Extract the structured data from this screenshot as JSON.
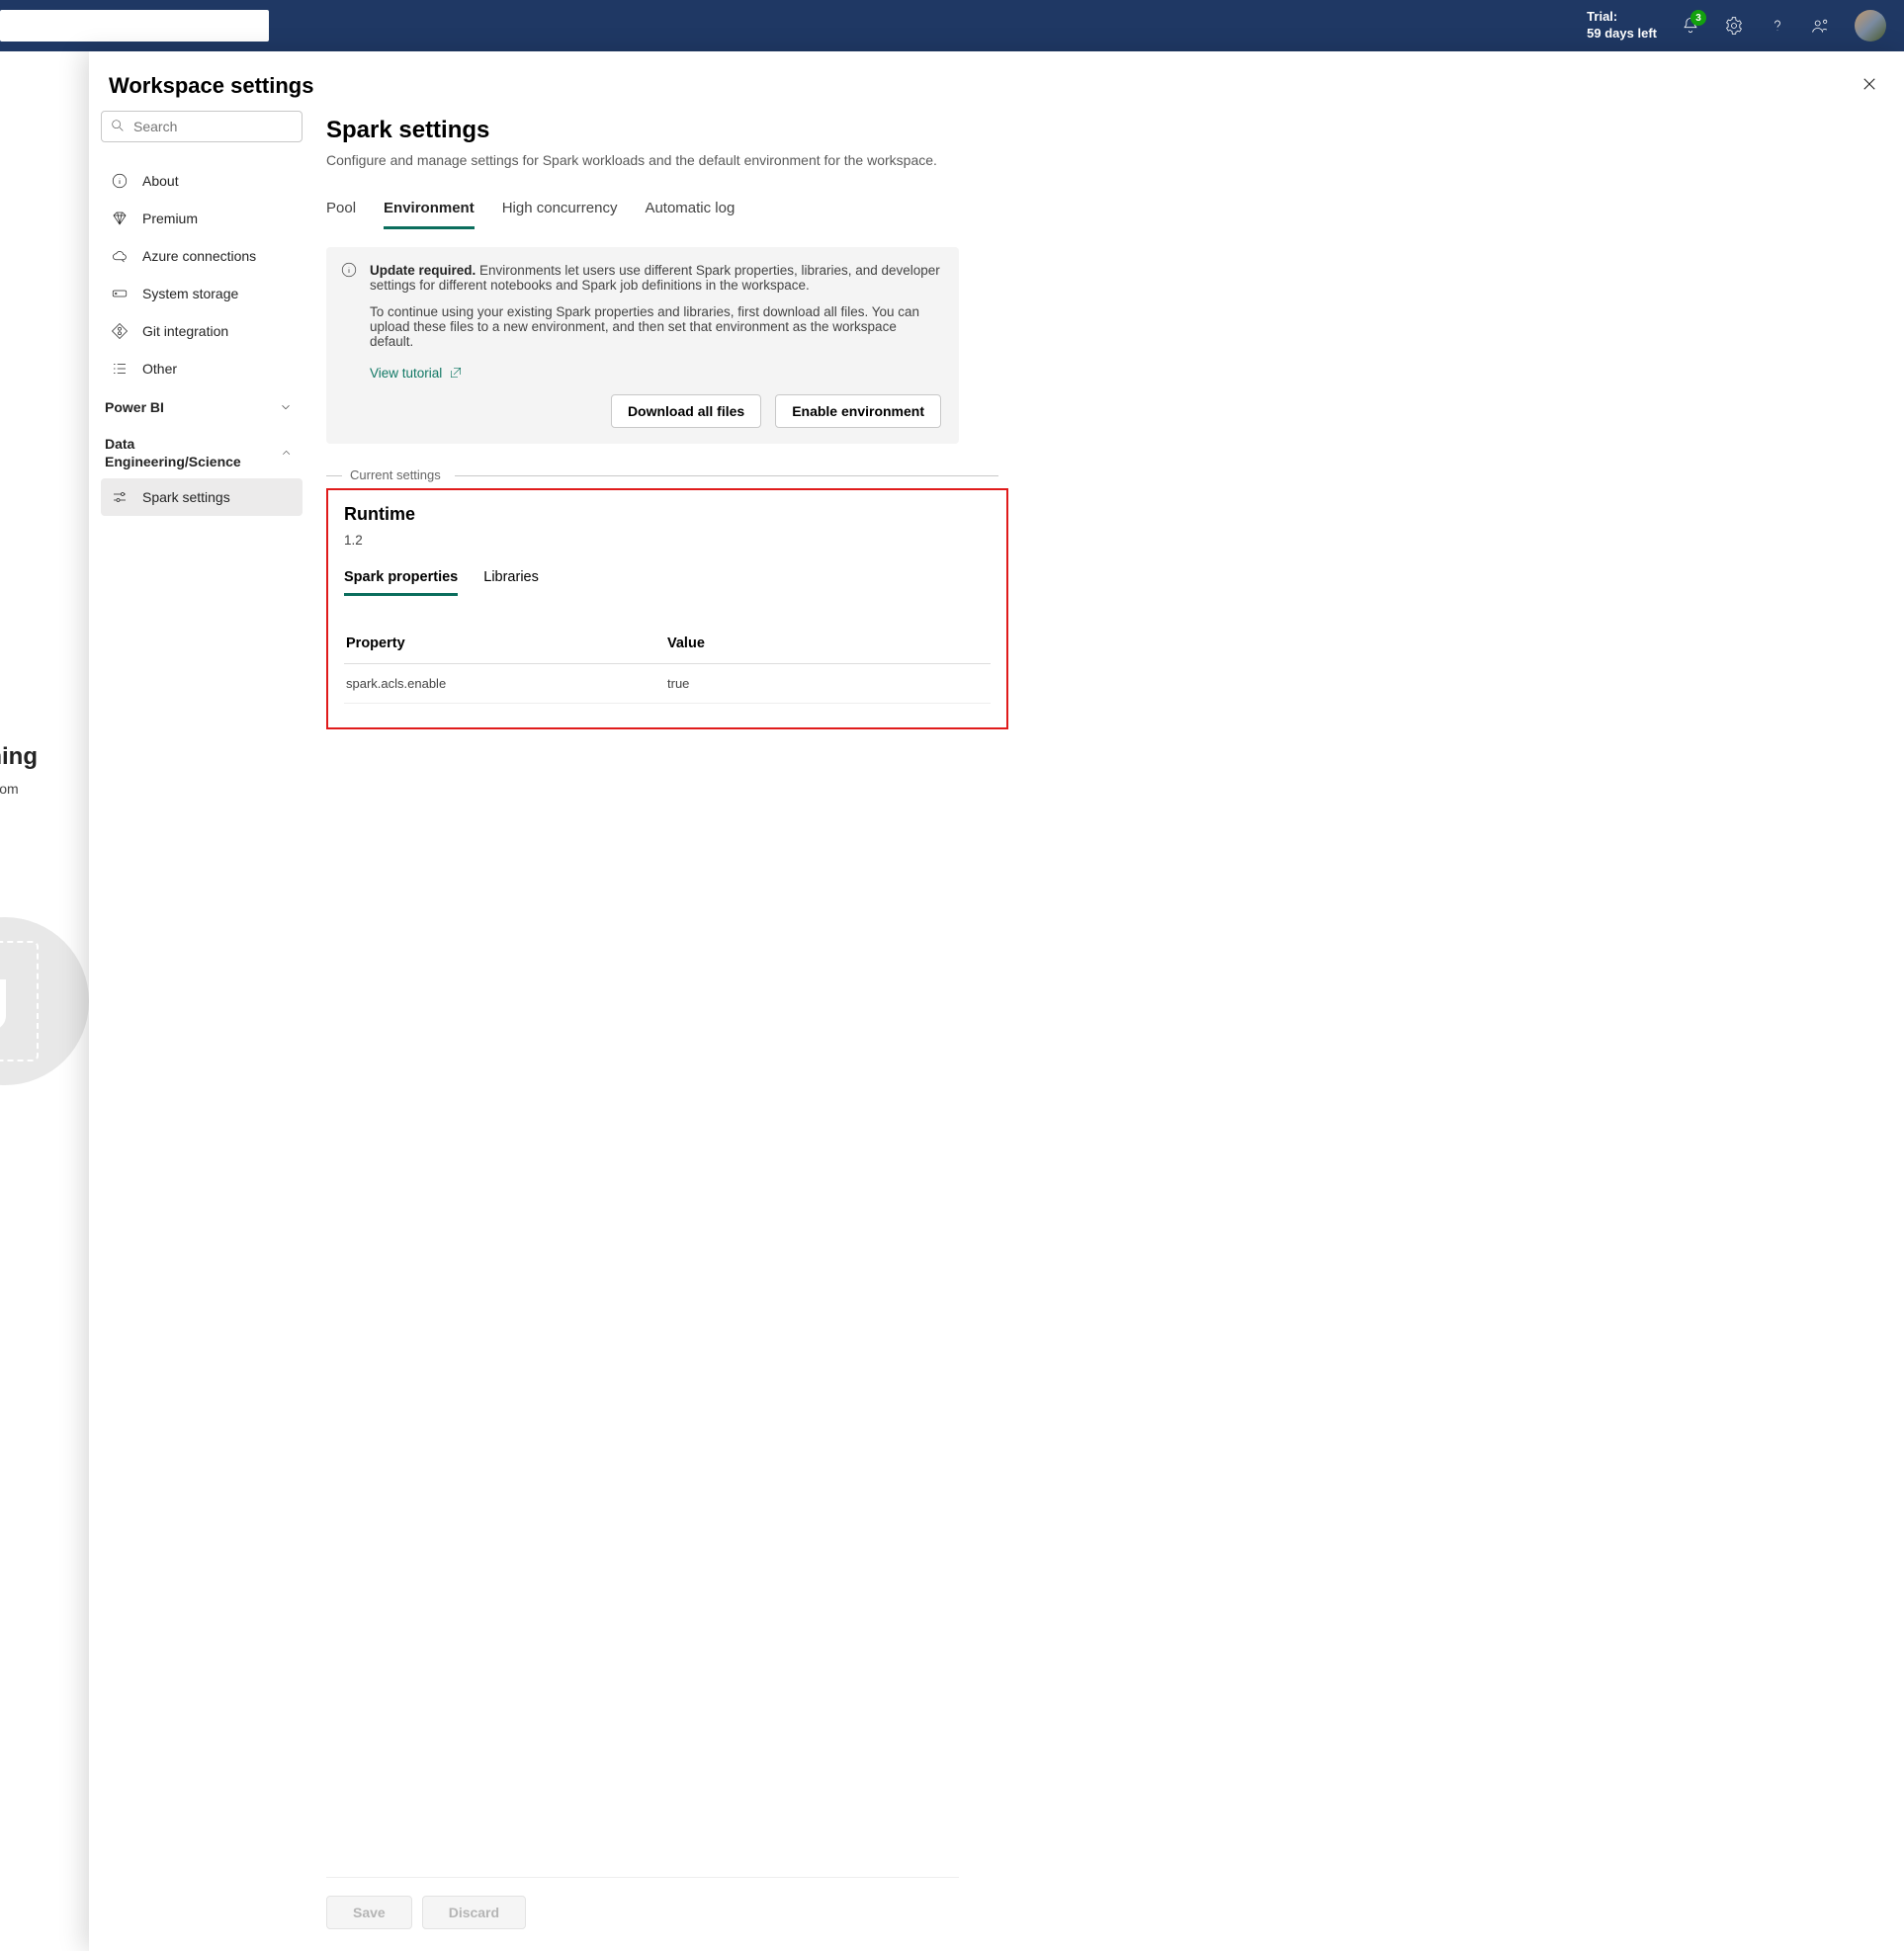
{
  "header": {
    "trial_line1": "Trial:",
    "trial_line2": "59 days left",
    "notification_count": "3"
  },
  "behind": {
    "title_fragment": "s nothing",
    "subtitle_fragment": "or upload som"
  },
  "panel": {
    "title": "Workspace settings",
    "search_placeholder": "Search"
  },
  "nav": {
    "items": [
      {
        "key": "about",
        "label": "About"
      },
      {
        "key": "premium",
        "label": "Premium"
      },
      {
        "key": "azure",
        "label": "Azure connections"
      },
      {
        "key": "storage",
        "label": "System storage"
      },
      {
        "key": "git",
        "label": "Git integration"
      },
      {
        "key": "other",
        "label": "Other"
      }
    ],
    "groups": {
      "powerbi": {
        "label": "Power BI"
      },
      "de": {
        "label": "Data Engineering/Science"
      }
    },
    "spark_settings_label": "Spark settings"
  },
  "main": {
    "title": "Spark settings",
    "description": "Configure and manage settings for Spark workloads and the default environment for the workspace.",
    "tabs": {
      "pool": "Pool",
      "environment": "Environment",
      "highconc": "High concurrency",
      "autolog": "Automatic log"
    },
    "notice": {
      "bold": "Update required.",
      "p1": "Environments let users use different Spark properties, libraries, and developer settings for different notebooks and Spark job definitions in the workspace.",
      "p2": "To continue using your existing Spark properties and libraries, first download all files. You can upload these files to a new environment, and then set that environment as the workspace default.",
      "tutorial": "View tutorial",
      "download": "Download all files",
      "enable": "Enable environment"
    },
    "divider": "Current settings",
    "runtime": {
      "heading": "Runtime",
      "version": "1.2",
      "subtabs": {
        "spark_props": "Spark properties",
        "libraries": "Libraries"
      },
      "columns": {
        "property": "Property",
        "value": "Value"
      },
      "rows": [
        {
          "property": "spark.acls.enable",
          "value": "true"
        }
      ]
    },
    "footer": {
      "save": "Save",
      "discard": "Discard"
    }
  }
}
